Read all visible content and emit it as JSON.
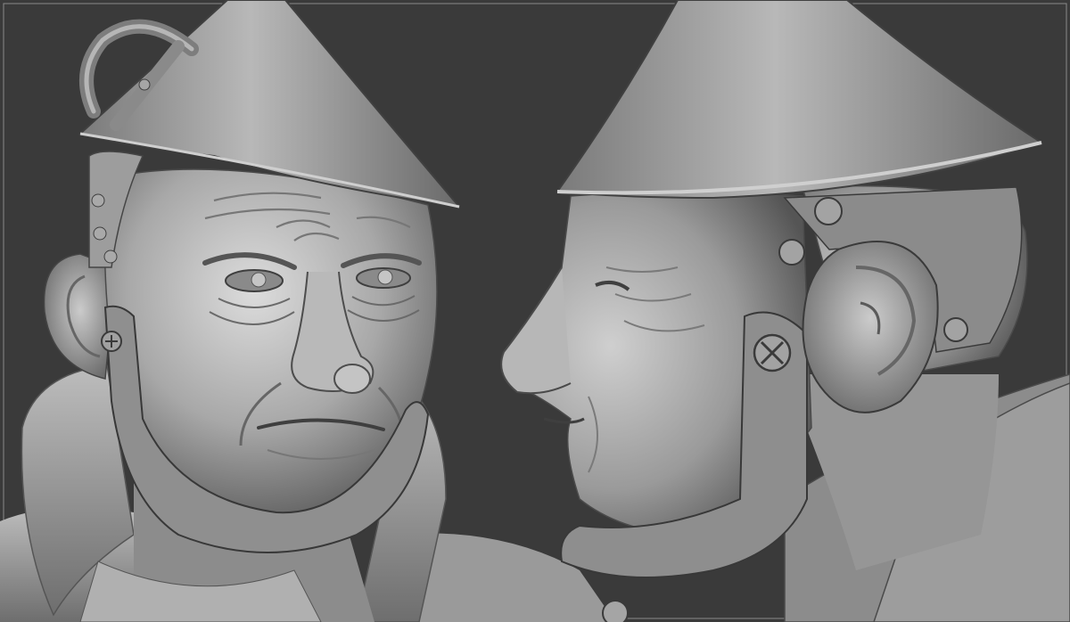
{
  "scene": {
    "background_color": "#3a3a3a",
    "clay_light": "#d2d2d2",
    "clay_mid": "#9c9c9c",
    "clay_dark": "#4a4a4a",
    "frame_line_color": "#8a8a8a"
  },
  "views": [
    {
      "name": "front-view",
      "subject": "tin-man-sculpt-front"
    },
    {
      "name": "profile-view",
      "subject": "tin-man-sculpt-profile"
    }
  ]
}
